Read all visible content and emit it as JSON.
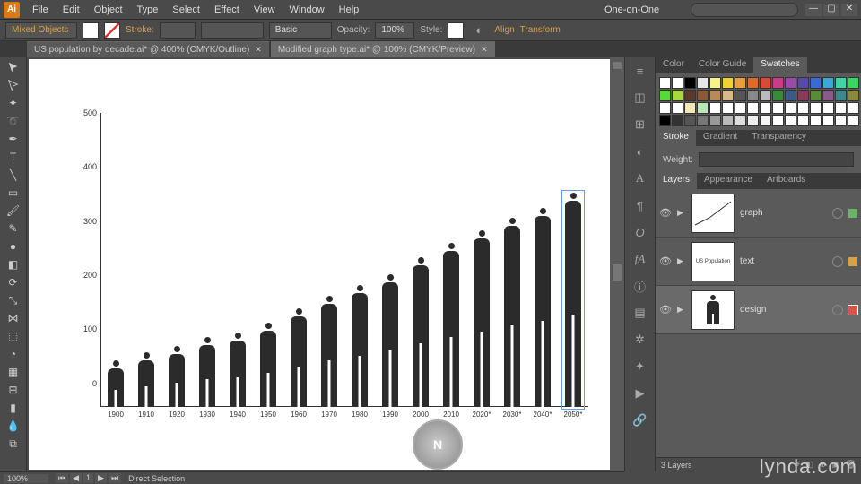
{
  "app": {
    "logo": "Ai"
  },
  "menu": {
    "items": [
      "File",
      "Edit",
      "Object",
      "Type",
      "Select",
      "Effect",
      "View",
      "Window",
      "Help"
    ]
  },
  "header_right": {
    "workspace": "One-on-One"
  },
  "control": {
    "selection": "Mixed Objects",
    "stroke_label": "Stroke:",
    "brush_label": "Basic",
    "opacity_label": "Opacity:",
    "opacity_value": "100%",
    "style_label": "Style:",
    "align_label": "Align",
    "transform_label": "Transform"
  },
  "tabs": [
    {
      "label": "US population by decade.ai* @ 400% (CMYK/Outline)",
      "active": false
    },
    {
      "label": "Modified graph type.ai* @ 100% (CMYK/Preview)",
      "active": true
    }
  ],
  "panels": {
    "color_tabs": [
      "Color",
      "Color Guide",
      "Swatches"
    ],
    "color_active": 2,
    "stroke_tabs": [
      "Stroke",
      "Gradient",
      "Transparency"
    ],
    "stroke_active": 0,
    "weight_label": "Weight:",
    "layer_tabs": [
      "Layers",
      "Appearance",
      "Artboards"
    ],
    "layer_active": 0,
    "layers": [
      {
        "name": "graph",
        "color": "#6bb36b"
      },
      {
        "name": "text",
        "color": "#d9a04a"
      },
      {
        "name": "design",
        "color": "#d9554a"
      }
    ],
    "layer_status": "3 Layers"
  },
  "swatch_colors": [
    "#ffffff",
    "#ffffff",
    "#000000",
    "#e6e6e6",
    "#f7f28b",
    "#f2d233",
    "#e8a03a",
    "#e06a2a",
    "#d84a3a",
    "#cc3a88",
    "#9a4aa8",
    "#5a4aa8",
    "#3a6ad8",
    "#3aa8d8",
    "#3ad8a8",
    "#3ad85a",
    "#5ad83a",
    "#a8d83a",
    "#5a3a2a",
    "#8a5a3a",
    "#b88a5a",
    "#d8b88a",
    "#555555",
    "#888888",
    "#bbbbbb",
    "#3a8a3a",
    "#3a5a8a",
    "#8a3a5a",
    "#5a8a3a",
    "#8a5a8a",
    "#3a8a8a",
    "#8a8a3a",
    "#ffffff",
    "#ffffff",
    "#f2e8b8",
    "#b8e8b8",
    "#ffffff",
    "#ffffff",
    "#ffffff",
    "#ffffff",
    "#ffffff",
    "#ffffff",
    "#ffffff",
    "#ffffff",
    "#ffffff",
    "#ffffff",
    "#ffffff",
    "#ffffff",
    "#000000",
    "#333333",
    "#555555",
    "#777777",
    "#999999",
    "#bbbbbb",
    "#dddddd",
    "#eeeeee",
    "#f5f5f5",
    "#ffffff",
    "#ffffff",
    "#ffffff",
    "#ffffff",
    "#ffffff",
    "#ffffff",
    "#ffffff"
  ],
  "status": {
    "zoom": "100%",
    "artboard": "1",
    "tool": "Direct Selection"
  },
  "watermark": "lynda.com",
  "chart_data": {
    "type": "bar",
    "title": "US population by decade",
    "xlabel": "",
    "ylabel": "",
    "ylim": [
      0,
      500
    ],
    "yticks": [
      0,
      100,
      200,
      300,
      400,
      500
    ],
    "categories": [
      "1900",
      "1910",
      "1920",
      "1930",
      "1940",
      "1950",
      "1960",
      "1970",
      "1980",
      "1990",
      "2000",
      "2010",
      "2020*",
      "2030*",
      "2040*",
      "2050*"
    ],
    "values": [
      76,
      92,
      106,
      123,
      132,
      152,
      180,
      205,
      227,
      249,
      282,
      310,
      335,
      360,
      380,
      410
    ],
    "selected_index": 15
  }
}
